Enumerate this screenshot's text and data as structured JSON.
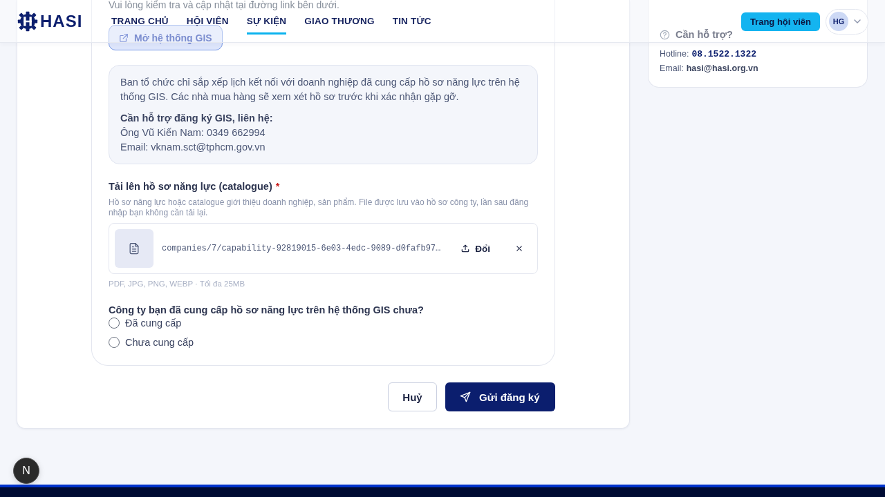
{
  "header": {
    "logo": {
      "text": "HASI"
    },
    "nav": [
      {
        "label": "TRANG CHỦ",
        "selected": false
      },
      {
        "label": "HỘI VIÊN",
        "selected": false
      },
      {
        "label": "SỰ KIỆN",
        "selected": true
      },
      {
        "label": "GIAO THƯƠNG",
        "selected": false
      },
      {
        "label": "TIN TỨC",
        "selected": false
      }
    ],
    "member_button": "Trang hội viên",
    "avatar": {
      "initials": "HG"
    }
  },
  "form": {
    "notice": "Vui lòng kiểm tra và cập nhật tại đường link bên dưới.",
    "gis_button": "Mở hệ thống GIS",
    "info": {
      "text": "Ban tổ chức chỉ sắp xếp lịch kết nối với doanh nghiệp đã cung cấp hồ sơ năng lực trên hệ thống GIS. Các nhà mua hàng sẽ xem xét hồ sơ trước khi xác nhận gặp gỡ.",
      "contact_title": "Cần hỗ trợ đăng ký GIS, liên hệ:",
      "contact_lines": [
        "Ông Vũ Kiến Nam: 0349 662994",
        "Email: vknam.sct@tphcm.gov.vn"
      ]
    },
    "upload": {
      "label": "Tải lên hồ sơ năng lực (catalogue)",
      "required_mark": "*",
      "help": "Hồ sơ năng lực hoặc catalogue giới thiệu doanh nghiệp, sản phẩm. File được lưu vào hồ sơ công ty, lần sau đăng nhập bạn không cần tải lại.",
      "file": {
        "path": "companies/7/capability-92819015-6e03-4edc-9089-d0fafb97…",
        "change_button": "Đổi"
      },
      "formats": "PDF, JPG, PNG, WEBP · Tối đa 25MB"
    },
    "question": {
      "label": "Công ty bạn đã cung cấp hồ sơ năng lực trên hệ thống GIS chưa?",
      "options": [
        {
          "label": "Đã cung cấp",
          "selected": false
        },
        {
          "label": "Chưa cung cấp",
          "selected": false
        }
      ]
    }
  },
  "actions": [
    {
      "label": "Huỷ",
      "kind": "secondary"
    },
    {
      "label": "Gửi đăng ký",
      "kind": "primary"
    }
  ],
  "support": {
    "title": "Cần hỗ trợ?",
    "rows": [
      {
        "label": "Hotline:",
        "value": "08.1522.1322",
        "kind": "phone"
      },
      {
        "label": "Email:",
        "value": "hasi@hasi.org.vn",
        "kind": "email"
      }
    ]
  },
  "dev_badge": "N"
}
